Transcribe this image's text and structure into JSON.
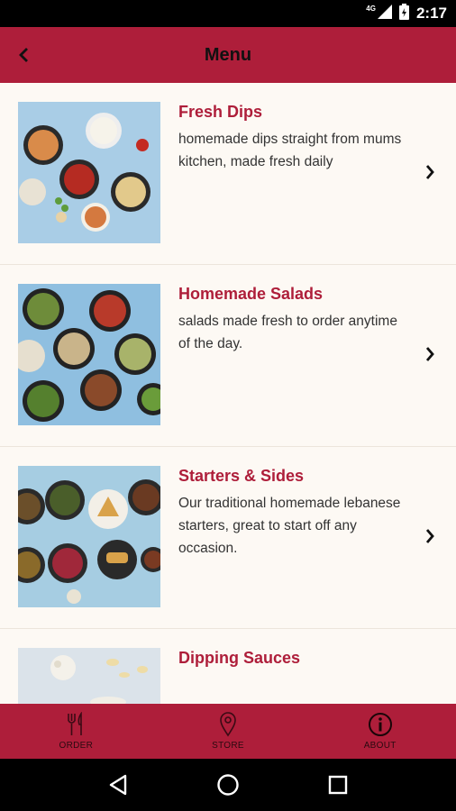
{
  "status_bar": {
    "time": "2:17",
    "network": "4G"
  },
  "header": {
    "title": "Menu"
  },
  "menu_items": [
    {
      "title": "Fresh Dips",
      "description": "homemade dips straight from mums kitchen, made fresh daily"
    },
    {
      "title": "Homemade Salads",
      "description": "salads made fresh to order anytime of the day."
    },
    {
      "title": "Starters & Sides",
      "description": "Our traditional homemade lebanese starters, great to start off any occasion."
    },
    {
      "title": "Dipping Sauces",
      "description": ""
    }
  ],
  "bottom_nav": [
    {
      "label": "ORDER",
      "icon": "fork-knife-icon"
    },
    {
      "label": "STORE",
      "icon": "location-pin-icon"
    },
    {
      "label": "ABOUT",
      "icon": "info-icon"
    }
  ],
  "colors": {
    "brand": "#ae1e3a",
    "background": "#fdf9f4",
    "title_text": "#ae1e3a"
  }
}
